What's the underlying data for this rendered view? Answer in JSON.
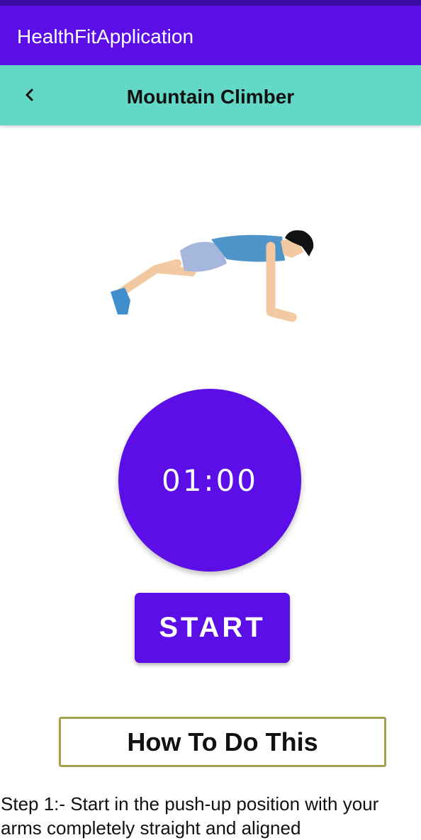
{
  "app_bar": {
    "title": "HealthFitApplication",
    "color": "#5b0ee6"
  },
  "toolbar": {
    "title": "Mountain Climber",
    "back_icon": "chevron-left-icon",
    "color": "#63d8c6"
  },
  "exercise": {
    "illustration": "mountain-climber-figure"
  },
  "timer": {
    "value": "01:00"
  },
  "start_button": {
    "label": "START"
  },
  "howto": {
    "title": "How To Do This",
    "instructions": "Step 1:- Start in the push-up position with your arms completely straight and aligned"
  }
}
